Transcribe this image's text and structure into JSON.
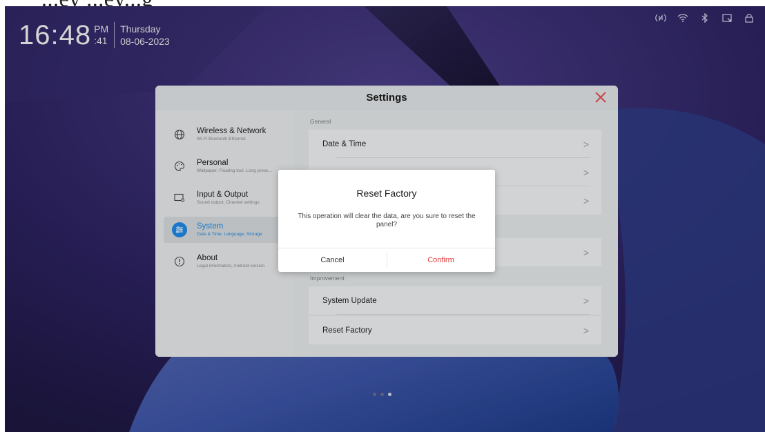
{
  "top_strip_text": "...ey                                                                                        ...ey...g",
  "clock": {
    "time": "16:48",
    "ampm": "PM",
    "seconds": ":41",
    "day": "Thursday",
    "date": "08-06-2023"
  },
  "status_icons": [
    "nfc-icon",
    "wifi-icon",
    "bluetooth-icon",
    "screen-share-icon",
    "lock-icon"
  ],
  "settings": {
    "title": "Settings",
    "sidebar": [
      {
        "title": "Wireless & Network",
        "subtitle": "Wi-Fi Bluetooth Ethernet",
        "icon": "globe-icon",
        "active": false
      },
      {
        "title": "Personal",
        "subtitle": "Wallpaper, Floating tool, Long press...",
        "icon": "palette-icon",
        "active": false
      },
      {
        "title": "Input & Output",
        "subtitle": "Sound output, Channel settings",
        "icon": "display-icon",
        "active": false
      },
      {
        "title": "System",
        "subtitle": "Date & Time, Language, Storage",
        "icon": "sliders-icon",
        "active": true
      },
      {
        "title": "About",
        "subtitle": "Legal information, Android version",
        "icon": "info-icon",
        "active": false
      }
    ],
    "sections": {
      "general": "General",
      "improvement": "Improvement"
    },
    "rows": {
      "date_time": "Date & Time",
      "system_update": "System Update",
      "reset_factory": "Reset Factory"
    },
    "chevron": ">"
  },
  "dialog": {
    "title": "Reset Factory",
    "message": "This operation will clear the data, are you sure to reset the panel?",
    "cancel": "Cancel",
    "confirm": "Confirm"
  },
  "colors": {
    "accent": "#1e88e5",
    "danger": "#e03a3a",
    "close": "#e35050"
  },
  "page_dots": {
    "count": 3,
    "active_index": 2
  }
}
